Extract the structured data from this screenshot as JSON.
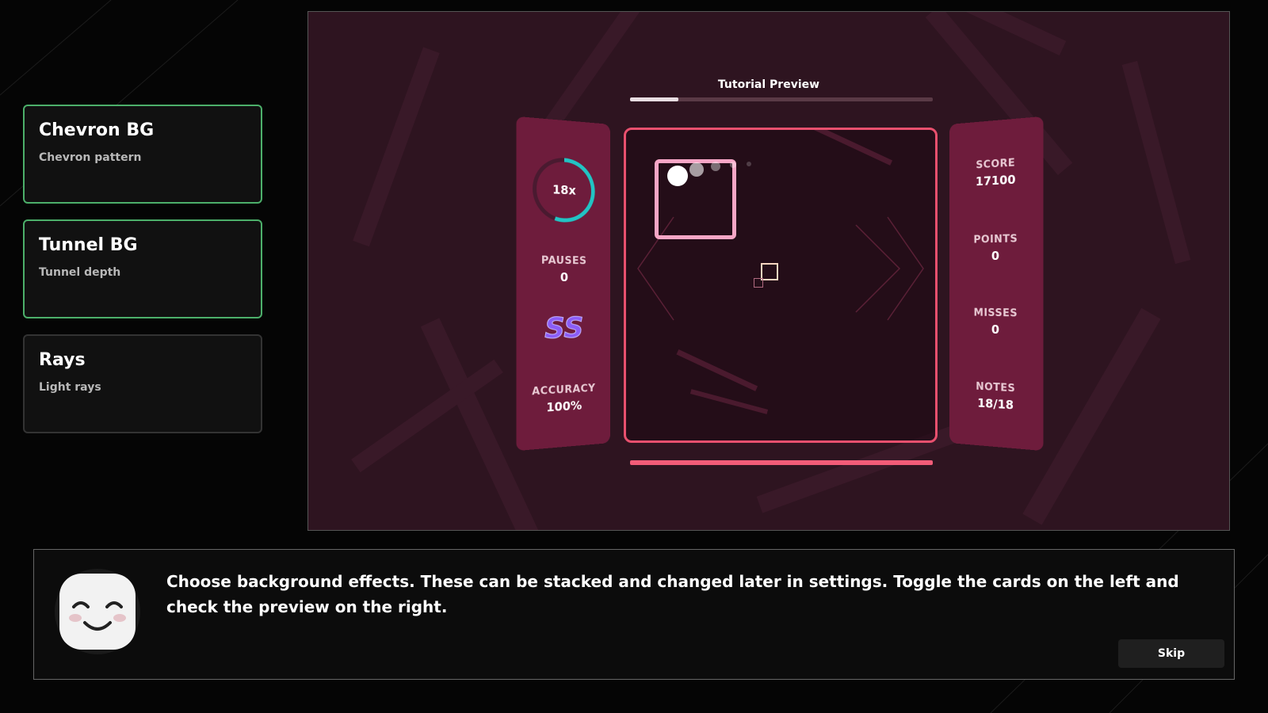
{
  "cards": [
    {
      "title": "Chevron BG",
      "subtitle": "Chevron pattern",
      "active": true
    },
    {
      "title": "Tunnel BG",
      "subtitle": "Tunnel depth",
      "active": true
    },
    {
      "title": "Rays",
      "subtitle": "Light rays",
      "active": false
    }
  ],
  "preview": {
    "title": "Tutorial Preview",
    "progress": 0.16,
    "health": 1.0,
    "left_panel": {
      "combo": "18x",
      "combo_progress": 0.55,
      "pauses_label": "PAUSES",
      "pauses_value": "0",
      "rank": "SS",
      "accuracy_label": "ACCURACY",
      "accuracy_value": "100%"
    },
    "right_panel": {
      "score_label": "SCORE",
      "score_value": "17100",
      "points_label": "POINTS",
      "points_value": "0",
      "misses_label": "MISSES",
      "misses_value": "0",
      "notes_label": "NOTES",
      "notes_value": "18/18"
    }
  },
  "dialog": {
    "text": "Choose background effects. These can be stacked and changed later in settings. Toggle the cards on the left and check the preview on the right.",
    "skip_label": "Skip"
  },
  "colors": {
    "card_active_border": "#4caf6a",
    "preview_bg": "#2e1420",
    "panel_bg": "#6e1c3c",
    "playfield_border": "#e8506e",
    "note_border": "#f7a6c6",
    "combo_ring": "#22c4c4",
    "rank": "#8b5cf6"
  }
}
